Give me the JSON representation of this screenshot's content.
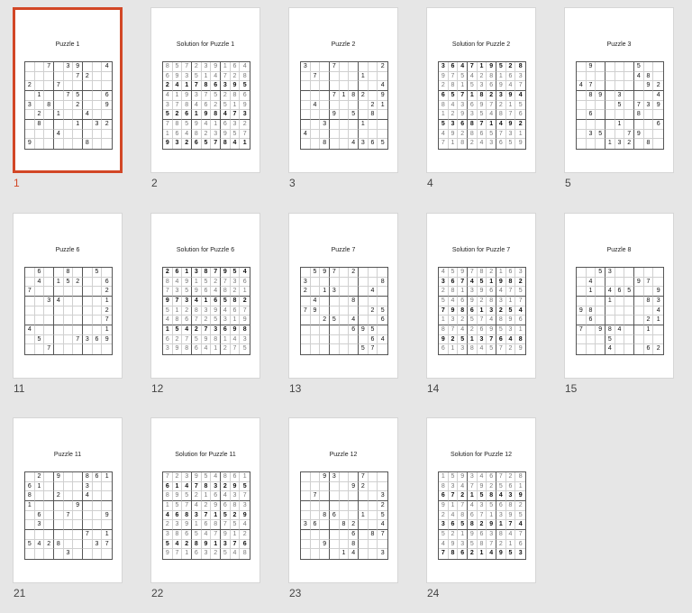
{
  "accent_color": "#d24726",
  "selected_slide": "1",
  "slides": [
    {
      "number": "1",
      "title": "Puzzle 1",
      "selected": true,
      "kind": "puzzle",
      "grid": [
        "  7 39  4",
        "     72  ",
        "2  7     ",
        " 1  75  6",
        "3 8  2  9",
        " 2 1  4  ",
        " 8   1 32",
        "   4     ",
        "9     8  "
      ]
    },
    {
      "number": "2",
      "title": "Solution for Puzzle 1",
      "kind": "solution",
      "grid": [
        "857239164",
        "693514728",
        "241786395",
        "419375286",
        "378462519",
        "526198473",
        "785941632",
        "164823957",
        "932657841"
      ]
    },
    {
      "number": "3",
      "title": "Puzzle 2",
      "kind": "puzzle",
      "grid": [
        "3  7    2",
        " 7    1  ",
        "        4",
        "   7182 9",
        " 4     21",
        "   9 5 8 ",
        "  3   1  ",
        "4        ",
        "  8  4365"
      ]
    },
    {
      "number": "4",
      "title": "Solution for Puzzle 2",
      "kind": "solution",
      "grid": [
        "364719528",
        "975428163",
        "281536947",
        "657182394",
        "843697215",
        "129354876",
        "536871492",
        "492865731",
        "718243659"
      ]
    },
    {
      "number": "5",
      "title": "Puzzle 3",
      "kind": "puzzle",
      "grid": [
        " 9    5  ",
        "      48 ",
        "47     92",
        " 89 3   4",
        "    5 739",
        " 6    8  ",
        "    1   6",
        " 35  79  ",
        "   132 8 "
      ]
    },
    {
      "number": "11",
      "title": "Puzzle 6",
      "kind": "puzzle",
      "grid": [
        " 6  8  5 ",
        " 4 152  6",
        "7       2",
        "  34    1",
        "        2",
        "        7",
        "4       1",
        " 5   73698",
        "  7      ",
        "3     1  "
      ]
    },
    {
      "number": "12",
      "title": "Solution for Puzzle 6",
      "kind": "solution",
      "grid": [
        "261387954",
        "849152736",
        "735964821",
        "973416582",
        "512839467",
        "486725319",
        "154273698",
        "627598143",
        "398641275"
      ]
    },
    {
      "number": "13",
      "title": "Puzzle 7",
      "kind": "puzzle",
      "grid": [
        " 597 2   ",
        "3       8",
        "2 13   4 ",
        " 4   8   ",
        "79     25",
        "  25 4  6",
        "     695 1",
        "       64",
        "      57 "
      ]
    },
    {
      "number": "14",
      "title": "Solution for Puzzle 7",
      "kind": "solution",
      "grid": [
        "459782163",
        "367451982",
        "281396475",
        "546928317",
        "798613254",
        "132574896",
        "874269531",
        "925137648",
        "613845729"
      ]
    },
    {
      "number": "15",
      "title": "Puzzle 8",
      "kind": "puzzle",
      "grid": [
        "  53     ",
        " 4    97 ",
        " 1 465  9",
        "   1   83",
        "98      4",
        " 6     21",
        "7 984  1 ",
        "   5     ",
        "   4   62"
      ]
    },
    {
      "number": "21",
      "title": "Puzzle 11",
      "kind": "puzzle",
      "grid": [
        " 2 9  861",
        "61    3  ",
        "8  2  4  ",
        "1    9   ",
        " 6  7   9",
        " 3       ",
        "      7 1",
        "5428   37",
        "    3    "
      ]
    },
    {
      "number": "22",
      "title": "Solution for Puzzle 11",
      "kind": "solution",
      "grid": [
        "723954861",
        "614783295",
        "895216437",
        "157429683",
        "468371529",
        "239168754",
        "386547912",
        "542891376",
        "971632548"
      ]
    },
    {
      "number": "23",
      "title": "Puzzle 12",
      "kind": "puzzle",
      "grid": [
        "  93  7  ",
        "     92  1",
        " 7      3",
        "        2",
        "  86  1 5",
        "36  82  4",
        "     6 87",
        "  9  8   ",
        "    14  3"
      ]
    },
    {
      "number": "24",
      "title": "Solution for Puzzle 12",
      "kind": "solution",
      "grid": [
        "159346728",
        "834792561",
        "672158439",
        "917435682",
        "248671395",
        "365829174",
        "521963847",
        "493587216",
        "786214953"
      ]
    }
  ]
}
